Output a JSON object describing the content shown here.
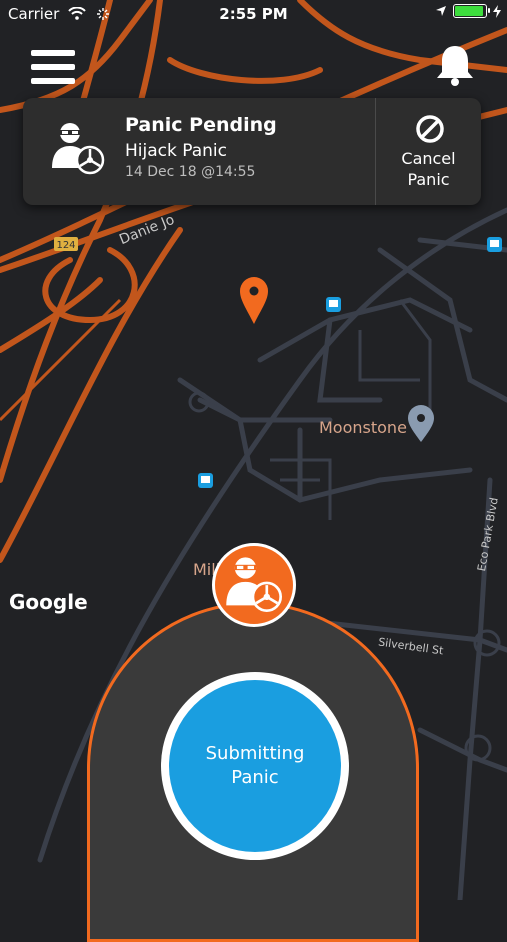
{
  "status_bar": {
    "carrier": "Carrier",
    "time": "2:55 PM"
  },
  "panic_card": {
    "title": "Panic Pending",
    "type": "Hijack Panic",
    "timestamp": "14 Dec 18 @14:55",
    "cancel_label_1": "Cancel",
    "cancel_label_2": "Panic"
  },
  "map": {
    "labels": {
      "moonstone": "Moonstone",
      "mill": "Mill",
      "silverbell": "Silverbell St",
      "ecopark": "Eco Park Blvd",
      "danie": "Danie Jo",
      "route": "124"
    },
    "attribution": "Google"
  },
  "action": {
    "submit_line1": "Submitting",
    "submit_line2": "Panic"
  },
  "colors": {
    "accent": "#f26a1f",
    "submit": "#1a9ee0",
    "road": "#c2561c",
    "card": "#2d2d2d"
  },
  "icons": [
    "menu-icon",
    "bell-icon",
    "hijacker-icon",
    "cancel-icon",
    "pin-icon",
    "bus-stop-icon"
  ]
}
